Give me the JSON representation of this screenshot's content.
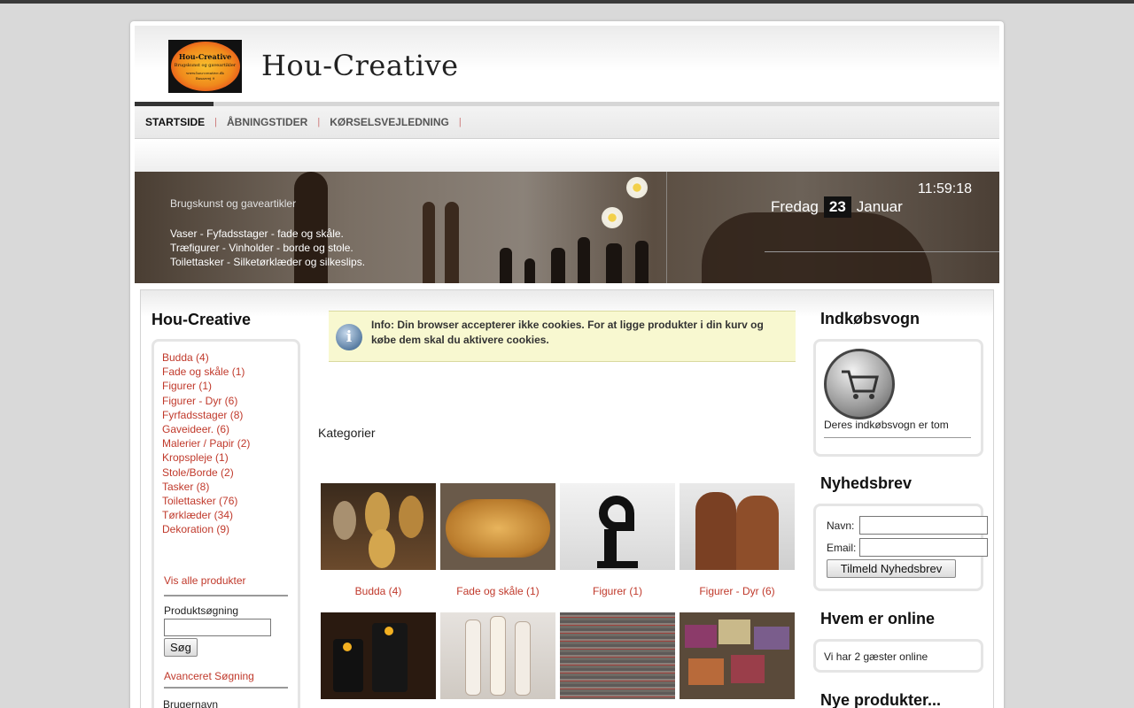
{
  "site": {
    "title": "Hou-Creative",
    "logo": {
      "line1": "Hou-Creative",
      "line2": "Brugskunst og gaveartikler",
      "line3": "www.hou-creative.dk",
      "line4": "Basarvej 9"
    }
  },
  "nav": {
    "items": [
      {
        "label": "STARTSIDE",
        "active": true
      },
      {
        "label": "ÅBNINGSTIDER",
        "active": false
      },
      {
        "label": "KØRSELSVEJLEDNING",
        "active": false
      }
    ]
  },
  "banner": {
    "subtitle": "Brugskunst og gaveartikler",
    "lines": [
      "Vaser - Fyfadsstager - fade og skåle.",
      "Træfigurer - Vinholder - borde og stole.",
      "Toilettasker - Silketørklæder og silkeslips."
    ],
    "time": "11:59:18",
    "weekday": "Fredag",
    "day": "23",
    "month": "Januar"
  },
  "left": {
    "title": "Hou-Creative",
    "categories": [
      "Budda (4)",
      "Fade og skåle (1)",
      "Figurer (1)",
      "Figurer - Dyr (6)",
      "Fyrfadsstager (8)",
      "Gaveideer. (6)",
      "Malerier / Papir (2)",
      "Kropspleje (1)",
      "Stole/Borde (2)",
      "Tasker (8)",
      "Toilettasker (76)",
      "Tørklæder (34)",
      "Dekoration (9)"
    ],
    "view_all": "Vis alle produkter",
    "search_label": "Produktsøgning",
    "search_button": "Søg",
    "advanced_search": "Avanceret Søgning",
    "username_label": "Brugernavn"
  },
  "main": {
    "info": "Info: Din browser accepterer ikke cookies. For at ligge produkter i din kurv og købe dem skal du aktivere cookies.",
    "categories_heading": "Kategorier",
    "tiles": [
      {
        "label": "Budda (4)"
      },
      {
        "label": "Fade og skåle (1)"
      },
      {
        "label": "Figurer (1)"
      },
      {
        "label": "Figurer - Dyr (6)"
      }
    ]
  },
  "right": {
    "cart_title": "Indkøbsvogn",
    "cart_empty": "Deres indkøbsvogn er tom",
    "newsletter_title": "Nyhedsbrev",
    "name_label": "Navn:",
    "email_label": "Email:",
    "subscribe_button": "Tilmeld Nyhedsbrev",
    "online_title": "Hvem er online",
    "online_text": "Vi har 2 gæster online",
    "new_products_title": "Nye produkter..."
  },
  "colors": {
    "link": "#c0392b",
    "info_bg": "#f8f8d0",
    "accent_dark": "#333333"
  }
}
